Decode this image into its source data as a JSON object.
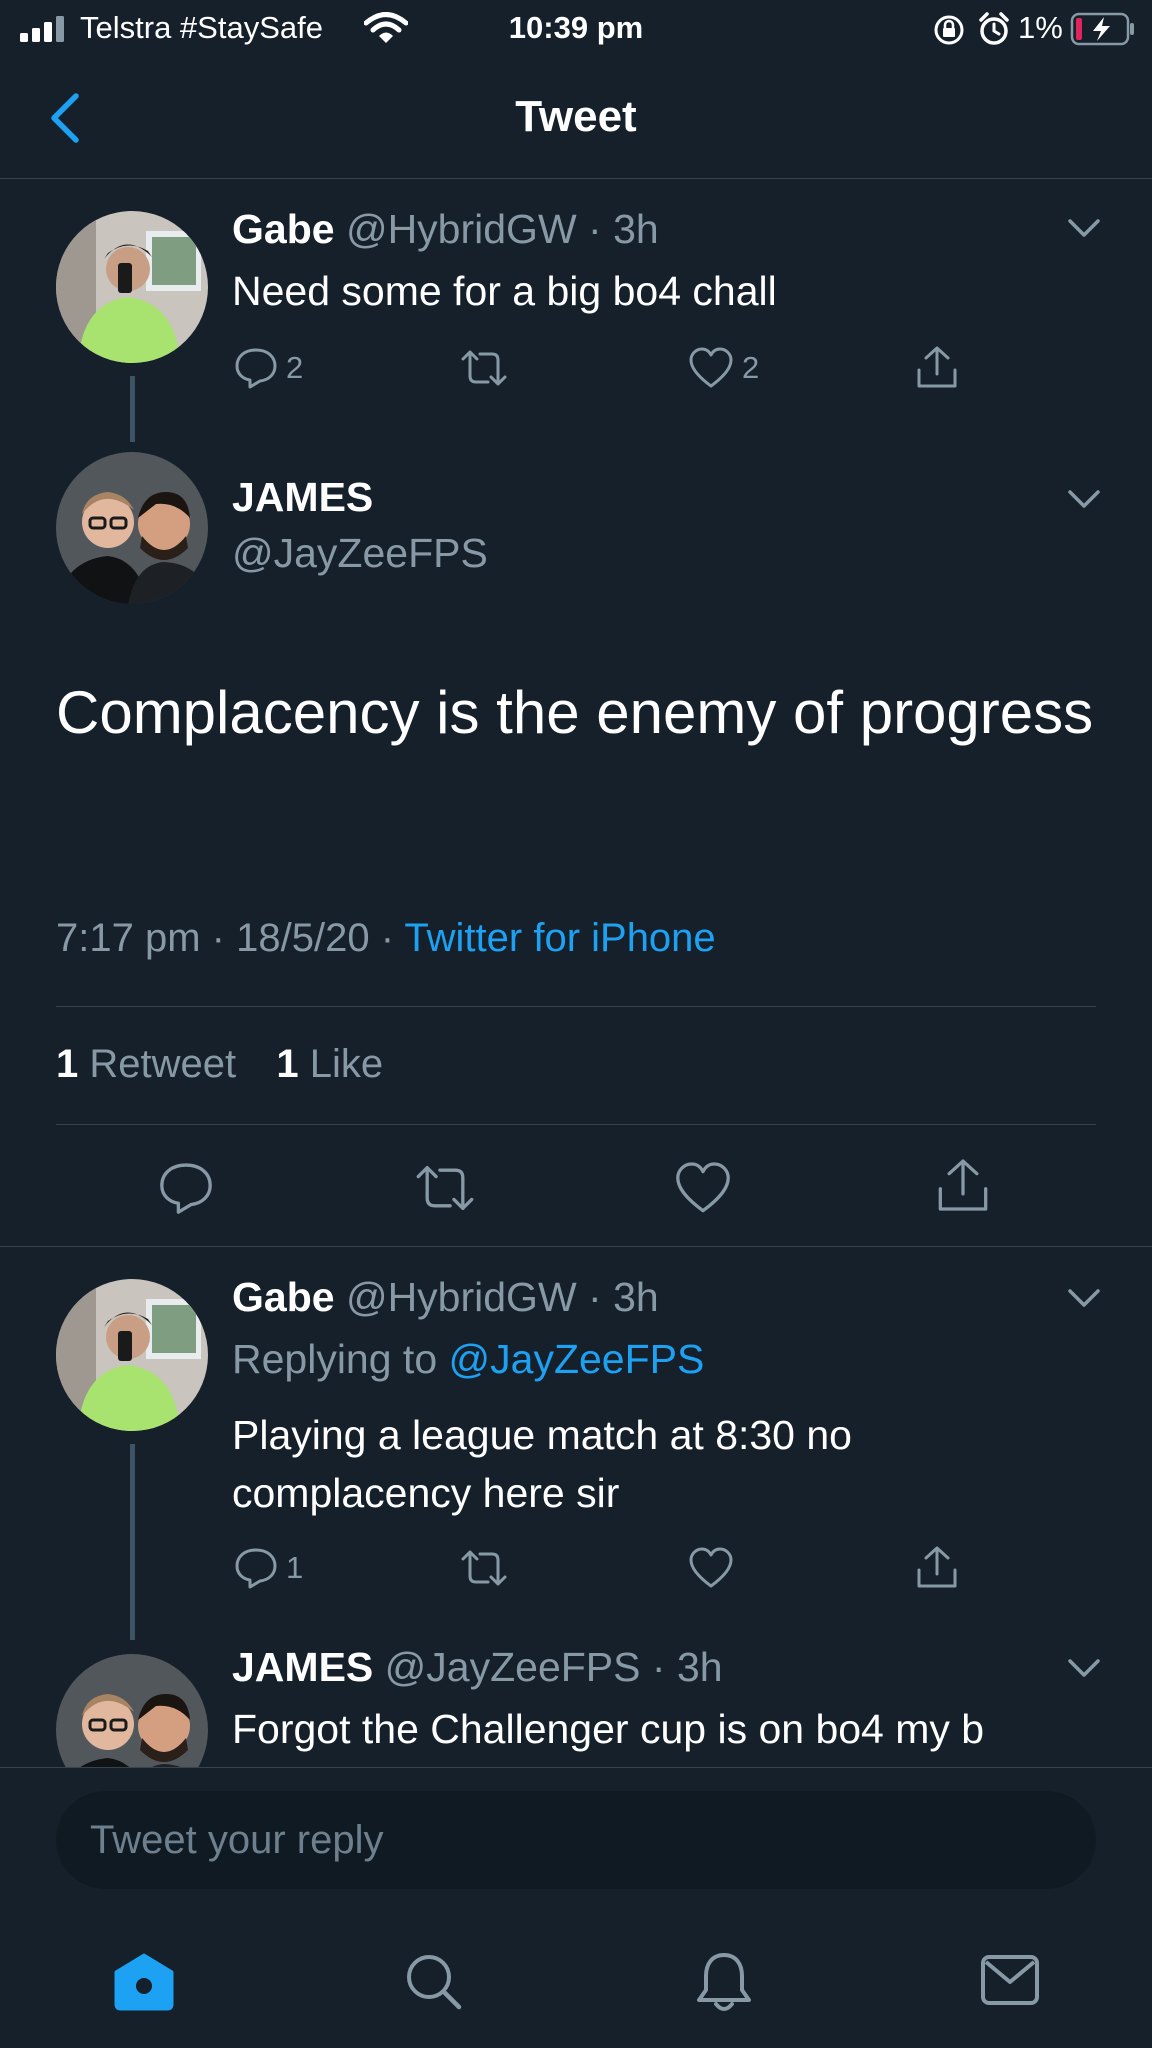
{
  "status_bar": {
    "carrier": "Telstra #StaySafe",
    "time": "10:39 pm",
    "battery": "1%"
  },
  "nav": {
    "title": "Tweet"
  },
  "parent_tweet": {
    "name": "Gabe",
    "handle": "@HybridGW",
    "dot": "·",
    "time": "3h",
    "text": "Need some for a big bo4 chall",
    "replies": "2",
    "likes": "2"
  },
  "main_tweet": {
    "name": "JAMES",
    "handle": "@JayZeeFPS",
    "text": "Complacency is the enemy of progress",
    "time": "7:17 pm",
    "dot": "·",
    "date": "18/5/20",
    "dot2": "·",
    "source": "Twitter for iPhone",
    "retweet_count": "1",
    "retweet_label": "Retweet",
    "like_count": "1",
    "like_label": "Like"
  },
  "reply_1": {
    "name": "Gabe",
    "handle": "@HybridGW",
    "dot": "·",
    "time": "3h",
    "replying_prefix": "Replying to",
    "replying_handle": "@JayZeeFPS",
    "text": "Playing a league match at 8:30 no complacency here sir",
    "replies": "1"
  },
  "reply_2": {
    "name": "JAMES",
    "handle": "@JayZeeFPS",
    "dot": "·",
    "time": "3h",
    "text": "Forgot the Challenger cup is on bo4 my b"
  },
  "composer": {
    "placeholder": "Tweet your reply"
  },
  "colors": {
    "background": "#15202b",
    "accent": "#1da1f2",
    "muted": "#8899a6",
    "divider": "#38444d"
  },
  "icons": {
    "back": "chevron-left-icon",
    "more": "chevron-down-icon",
    "reply": "comment-bubble-icon",
    "retweet": "retweet-arrows-icon",
    "like": "heart-icon",
    "share": "share-upload-icon",
    "home": "home-icon",
    "search": "search-icon",
    "notifications": "bell-icon",
    "messages": "envelope-icon"
  }
}
